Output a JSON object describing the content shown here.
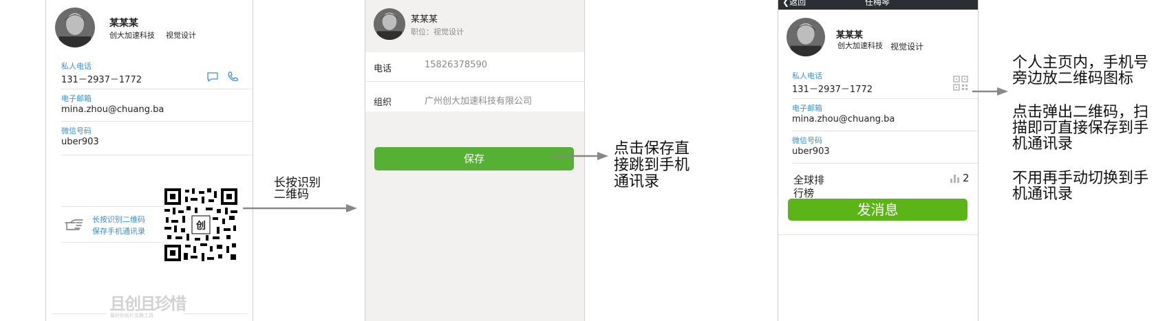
{
  "screen1": {
    "name": "某某某",
    "company": "创大加速科技",
    "role": "视觉设计",
    "phone_label": "私人电话",
    "phone": "131－2937－1772",
    "email_label": "电子邮箱",
    "email": "mina.zhou@chuang.ba",
    "wechat_label": "微信号码",
    "wechat": "uber903",
    "qr_hint_line1": "长按识别二维码",
    "qr_hint_line2": "保存手机通讯录",
    "qr_logo_text": "创",
    "watermark": "且创且珍惜",
    "watermark_sub": "最好的名片交换工具"
  },
  "annotation1": {
    "line1": "长按识别",
    "line2": "二维码"
  },
  "screen2": {
    "name": "某某某",
    "position": "职位：视觉设计",
    "phone_label": "电话",
    "phone_value": "15826378590",
    "org_label": "组织",
    "org_value": "广州创大加速科技有限公司",
    "save_button": "保存"
  },
  "annotation2": {
    "line1": "点击保存直",
    "line2": "接跳到手机",
    "line3": "通讯录"
  },
  "screen3": {
    "back_label": "返回",
    "header_title": "任梅琴",
    "name": "某某某",
    "company": "创大加速科技",
    "role": "视觉设计",
    "phone_label": "私人电话",
    "phone": "131－2937－1772",
    "email_label": "电子邮箱",
    "email": "mina.zhou@chuang.ba",
    "wechat_label": "微信号码",
    "wechat": "uber903",
    "rank_line1": "全球排",
    "rank_line2": "行榜",
    "rank_count": "2",
    "message_button": "发消息"
  },
  "annotation3": {
    "p1_line1": "个人主页内，手机号",
    "p1_line2": "旁边放二维码图标",
    "p2_line1": "点击弹出二维码，扫",
    "p2_line2": "描即可直接保存到手",
    "p2_line3": "机通讯录",
    "p3_line1": "不用再手动切换到手",
    "p3_line2": "机通讯录"
  },
  "colors": {
    "accent_blue": "#3a8ed6",
    "button_green": "#55b033",
    "header_dark": "#2b2f33"
  }
}
